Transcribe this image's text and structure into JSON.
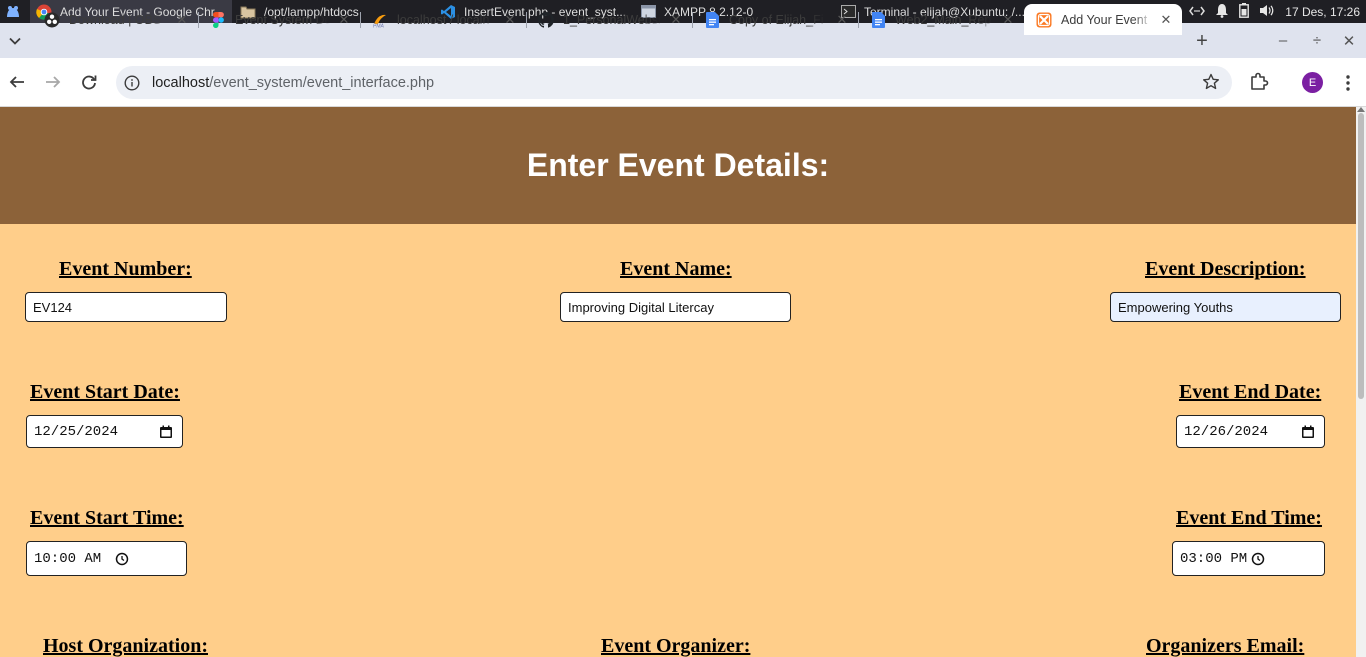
{
  "taskbar": {
    "tasks": [
      {
        "label": "Add Your Event - Google Chr...",
        "icon": "chrome-icon"
      },
      {
        "label": "/opt/lampp/htdocs",
        "icon": "folder-icon"
      },
      {
        "label": "InsertEvent.php - event_syst...",
        "icon": "vscode-icon"
      },
      {
        "label": "XAMPP 8.2.12-0",
        "icon": "window-icon"
      },
      {
        "label": "Terminal - elijah@Xubuntu: /...",
        "icon": "terminal-icon"
      }
    ],
    "clock": "17 Des, 17:26"
  },
  "browser": {
    "tabs": [
      {
        "label": "Download | OBS",
        "icon": "obs-icon"
      },
      {
        "label": "Event System De",
        "icon": "figma-icon"
      },
      {
        "label": "localhost / localh",
        "icon": "phpmyadmin-icon"
      },
      {
        "label": "1_PersonalWebsi",
        "icon": "github-icon"
      },
      {
        "label": "Copy of Elijah_Fi",
        "icon": "google-docs-icon"
      },
      {
        "label": "Web2_Main_Rep",
        "icon": "google-docs-icon"
      },
      {
        "label": "Add Your Event",
        "icon": "xampp-icon"
      }
    ],
    "url_host": "localhost",
    "url_path": "/event_system/event_interface.php",
    "profile_initial": "E"
  },
  "page": {
    "header": "Enter Event Details:",
    "fields": {
      "event_number": {
        "label": "Event Number:",
        "value": "EV124"
      },
      "event_name": {
        "label": "Event Name:",
        "value": "Improving Digital Litercay"
      },
      "event_description": {
        "label": "Event Description:",
        "value": "Empowering Youths"
      },
      "start_date": {
        "label": "Event Start Date:",
        "value": "12/25/2024"
      },
      "end_date": {
        "label": "Event End Date:",
        "value": "12/26/2024"
      },
      "start_time": {
        "label": "Event Start Time:",
        "value": "10:00 AM"
      },
      "end_time": {
        "label": "Event End Time:",
        "value": "03:00 PM"
      },
      "host_org": {
        "label": "Host Organization:"
      },
      "organizer": {
        "label": "Event Organizer:"
      },
      "organizer_email": {
        "label": "Organizers Email:"
      }
    }
  },
  "colors": {
    "page_background": "#ffce8a",
    "header_background": "#8c6239",
    "header_text": "#ffffff"
  }
}
